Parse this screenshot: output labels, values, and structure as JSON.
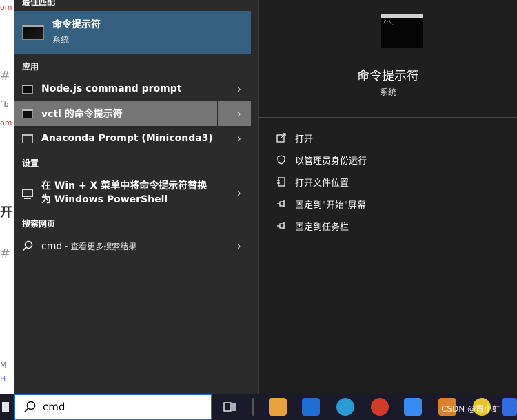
{
  "bg_fragments": [
    "om",
    "#",
    "`b",
    "om",
    "开",
    "#",
    "M",
    "H"
  ],
  "left": {
    "best_match_header": "最佳匹配",
    "best_match": {
      "title": "命令提示符",
      "subtitle": "系统"
    },
    "apps_header": "应用",
    "apps": [
      {
        "label": "Node.js command prompt"
      },
      {
        "label": "vctl 的命令提示符"
      },
      {
        "label": "Anaconda Prompt (Miniconda3)"
      }
    ],
    "settings_header": "设置",
    "settings_item": "在 Win + X 菜单中将命令提示符替换为 Windows PowerShell",
    "web_header": "搜索网页",
    "web_item": {
      "query": "cmd",
      "suffix": " - 查看更多搜索结果"
    }
  },
  "right": {
    "title": "命令提示符",
    "subtitle": "系统",
    "actions": [
      "打开",
      "以管理员身份运行",
      "打开文件位置",
      "固定到\"开始\"屏幕",
      "固定到任务栏"
    ]
  },
  "taskbar": {
    "search_query": "cmd",
    "watermark": "CSDN @胃小蛙",
    "colors": {
      "search_border": "#1d6fd6",
      "best_match_bg": "#35607f"
    }
  }
}
